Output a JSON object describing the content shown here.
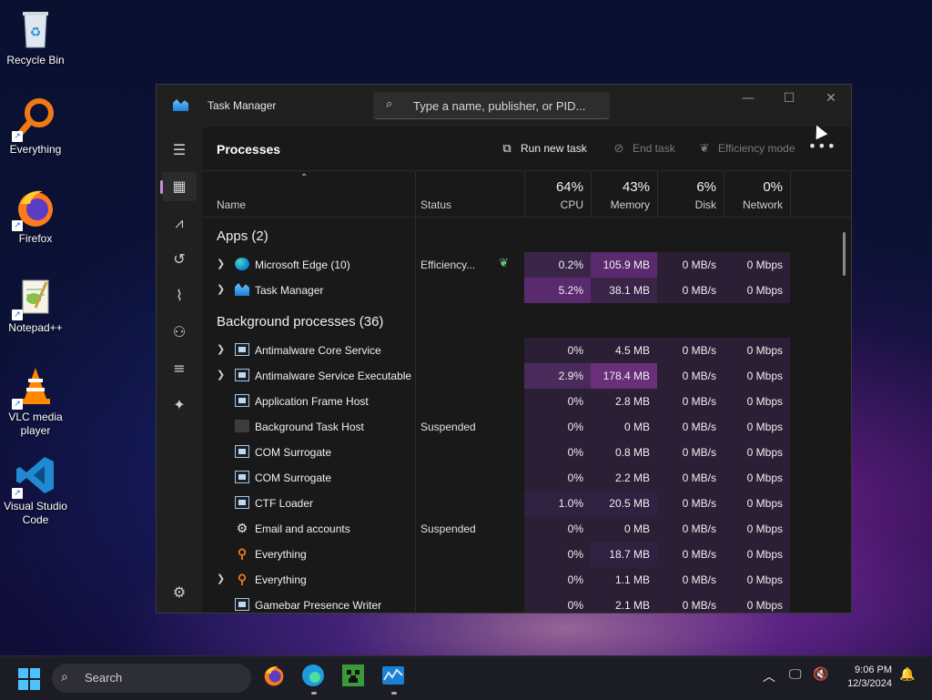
{
  "desktop": {
    "icons": [
      {
        "label": "Recycle Bin",
        "icon": "recycle-bin-icon"
      },
      {
        "label": "Everything",
        "icon": "everything-icon"
      },
      {
        "label": "Firefox",
        "icon": "firefox-icon"
      },
      {
        "label": "Notepad++",
        "icon": "notepad-plus-plus-icon"
      },
      {
        "label": "VLC media player",
        "icon": "vlc-icon"
      },
      {
        "label": "Visual Studio Code",
        "icon": "vscode-icon"
      }
    ]
  },
  "window": {
    "title": "Task Manager",
    "search_placeholder": "Type a name, publisher, or PID..."
  },
  "toolbar": {
    "page_title": "Processes",
    "run_new_task": "Run new task",
    "end_task": "End task",
    "efficiency_mode": "Efficiency mode"
  },
  "columns": {
    "name": "Name",
    "status": "Status",
    "cpu": {
      "pct": "64%",
      "label": "CPU"
    },
    "memory": {
      "pct": "43%",
      "label": "Memory"
    },
    "disk": {
      "pct": "6%",
      "label": "Disk"
    },
    "network": {
      "pct": "0%",
      "label": "Network"
    }
  },
  "groups": {
    "apps": "Apps (2)",
    "background": "Background processes (36)"
  },
  "apps": [
    {
      "name": "Microsoft Edge (10)",
      "status": "Efficiency...",
      "cpu": "0.2%",
      "mem": "105.9 MB",
      "disk": "0 MB/s",
      "net": "0 Mbps"
    },
    {
      "name": "Task Manager",
      "status": "",
      "cpu": "5.2%",
      "mem": "38.1 MB",
      "disk": "0 MB/s",
      "net": "0 Mbps"
    }
  ],
  "background": [
    {
      "name": "Antimalware Core Service",
      "status": "",
      "cpu": "0%",
      "mem": "4.5 MB",
      "disk": "0 MB/s",
      "net": "0 Mbps"
    },
    {
      "name": "Antimalware Service Executable",
      "status": "",
      "cpu": "2.9%",
      "mem": "178.4 MB",
      "disk": "0 MB/s",
      "net": "0 Mbps"
    },
    {
      "name": "Application Frame Host",
      "status": "",
      "cpu": "0%",
      "mem": "2.8 MB",
      "disk": "0 MB/s",
      "net": "0 Mbps"
    },
    {
      "name": "Background Task Host",
      "status": "Suspended",
      "cpu": "0%",
      "mem": "0 MB",
      "disk": "0 MB/s",
      "net": "0 Mbps"
    },
    {
      "name": "COM Surrogate",
      "status": "",
      "cpu": "0%",
      "mem": "0.8 MB",
      "disk": "0 MB/s",
      "net": "0 Mbps"
    },
    {
      "name": "COM Surrogate",
      "status": "",
      "cpu": "0%",
      "mem": "2.2 MB",
      "disk": "0 MB/s",
      "net": "0 Mbps"
    },
    {
      "name": "CTF Loader",
      "status": "",
      "cpu": "1.0%",
      "mem": "20.5 MB",
      "disk": "0 MB/s",
      "net": "0 Mbps"
    },
    {
      "name": "Email and accounts",
      "status": "Suspended",
      "cpu": "0%",
      "mem": "0 MB",
      "disk": "0 MB/s",
      "net": "0 Mbps"
    },
    {
      "name": "Everything",
      "status": "",
      "cpu": "0%",
      "mem": "18.7 MB",
      "disk": "0 MB/s",
      "net": "0 Mbps"
    },
    {
      "name": "Everything",
      "status": "",
      "cpu": "0%",
      "mem": "1.1 MB",
      "disk": "0 MB/s",
      "net": "0 Mbps"
    },
    {
      "name": "Gamebar Presence Writer",
      "status": "",
      "cpu": "0%",
      "mem": "2.1 MB",
      "disk": "0 MB/s",
      "net": "0 Mbps"
    }
  ],
  "taskbar": {
    "search_label": "Search",
    "time": "9:06 PM",
    "date": "12/3/2024"
  },
  "colors": {
    "heat_low": "#2a1f35",
    "heat_mid": "#4a2a5a",
    "heat_high": "#6a2f7a",
    "accent": "#c78be0"
  }
}
